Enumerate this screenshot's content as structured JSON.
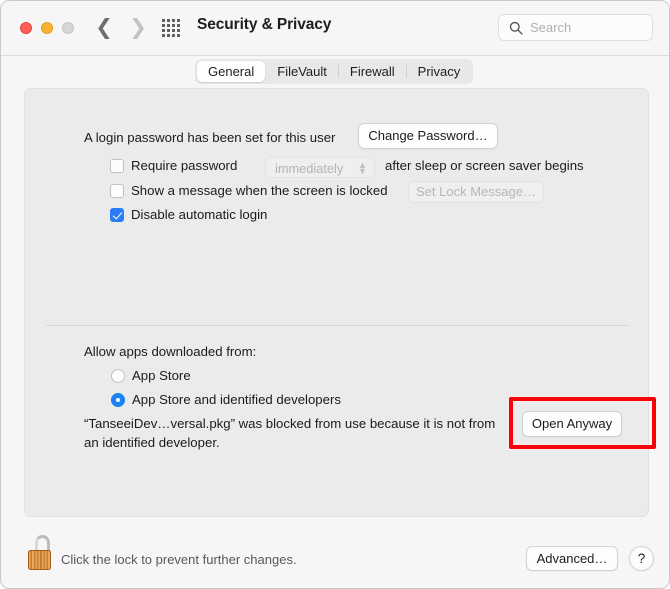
{
  "window": {
    "title": "Security & Privacy",
    "traffic_lights": [
      {
        "name": "close",
        "color": "#ff5f57"
      },
      {
        "name": "minimize",
        "color": "#f9b32f"
      },
      {
        "name": "zoom",
        "color": "#d6d6d6"
      }
    ],
    "nav": {
      "back_icon": "chevron-left-icon",
      "forward_icon": "chevron-right-icon",
      "grid_icon": "grid-of-dots-icon"
    },
    "search": {
      "icon": "search-icon",
      "placeholder": "Search",
      "value": ""
    }
  },
  "tabs": [
    {
      "label": "General",
      "active": true
    },
    {
      "label": "FileVault",
      "active": false
    },
    {
      "label": "Firewall",
      "active": false
    },
    {
      "label": "Privacy",
      "active": false
    }
  ],
  "general": {
    "password_status": "A login password has been set for this user",
    "change_password_button": "Change Password…",
    "require_password": {
      "label": "Require password",
      "checked": false,
      "popup_value": "immediately",
      "popup_enabled": false,
      "suffix": "after sleep or screen saver begins"
    },
    "show_message": {
      "label": "Show a message when the screen is locked",
      "checked": false,
      "button": "Set Lock Message…",
      "button_enabled": false
    },
    "disable_auto_login": {
      "label": "Disable automatic login",
      "checked": true
    }
  },
  "gatekeeper": {
    "heading": "Allow apps downloaded from:",
    "options": [
      {
        "label": "App Store",
        "selected": false
      },
      {
        "label": "App Store and identified developers",
        "selected": true
      }
    ],
    "blocked_message_line1": "“TanseeiDev…versal.pkg” was blocked from use because it is not from",
    "blocked_message_line2": "an identified developer.",
    "open_anyway_button": "Open Anyway"
  },
  "annotation": {
    "shape": "rectangle",
    "color": "#fb0007",
    "target": "Open Anyway"
  },
  "footer": {
    "lock_icon": "open-padlock-icon",
    "lock_text": "Click the lock to prevent further changes.",
    "advanced_button": "Advanced…",
    "help_button": "?"
  }
}
